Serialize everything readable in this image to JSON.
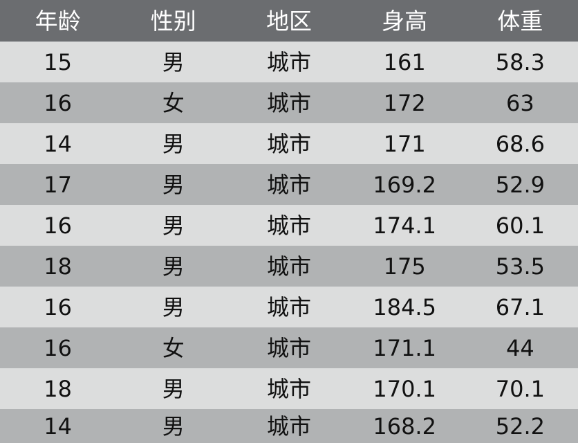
{
  "table": {
    "headers": [
      "年龄",
      "性别",
      "地区",
      "身高",
      "体重"
    ],
    "rows": [
      [
        "15",
        "男",
        "城市",
        "161",
        "58.3"
      ],
      [
        "16",
        "女",
        "城市",
        "172",
        "63"
      ],
      [
        "14",
        "男",
        "城市",
        "171",
        "68.6"
      ],
      [
        "17",
        "男",
        "城市",
        "169.2",
        "52.9"
      ],
      [
        "16",
        "男",
        "城市",
        "174.1",
        "60.1"
      ],
      [
        "18",
        "男",
        "城市",
        "175",
        "53.5"
      ],
      [
        "16",
        "男",
        "城市",
        "184.5",
        "67.1"
      ],
      [
        "16",
        "女",
        "城市",
        "171.1",
        "44"
      ],
      [
        "18",
        "男",
        "城市",
        "170.1",
        "70.1"
      ],
      [
        "14",
        "男",
        "城市",
        "168.2",
        "52.2"
      ]
    ]
  },
  "colors": {
    "header_bg": "#6b6d70",
    "header_text": "#ffffff",
    "row_light": "#dcdddd",
    "row_dark": "#b1b3b4",
    "cell_text": "#111111"
  }
}
